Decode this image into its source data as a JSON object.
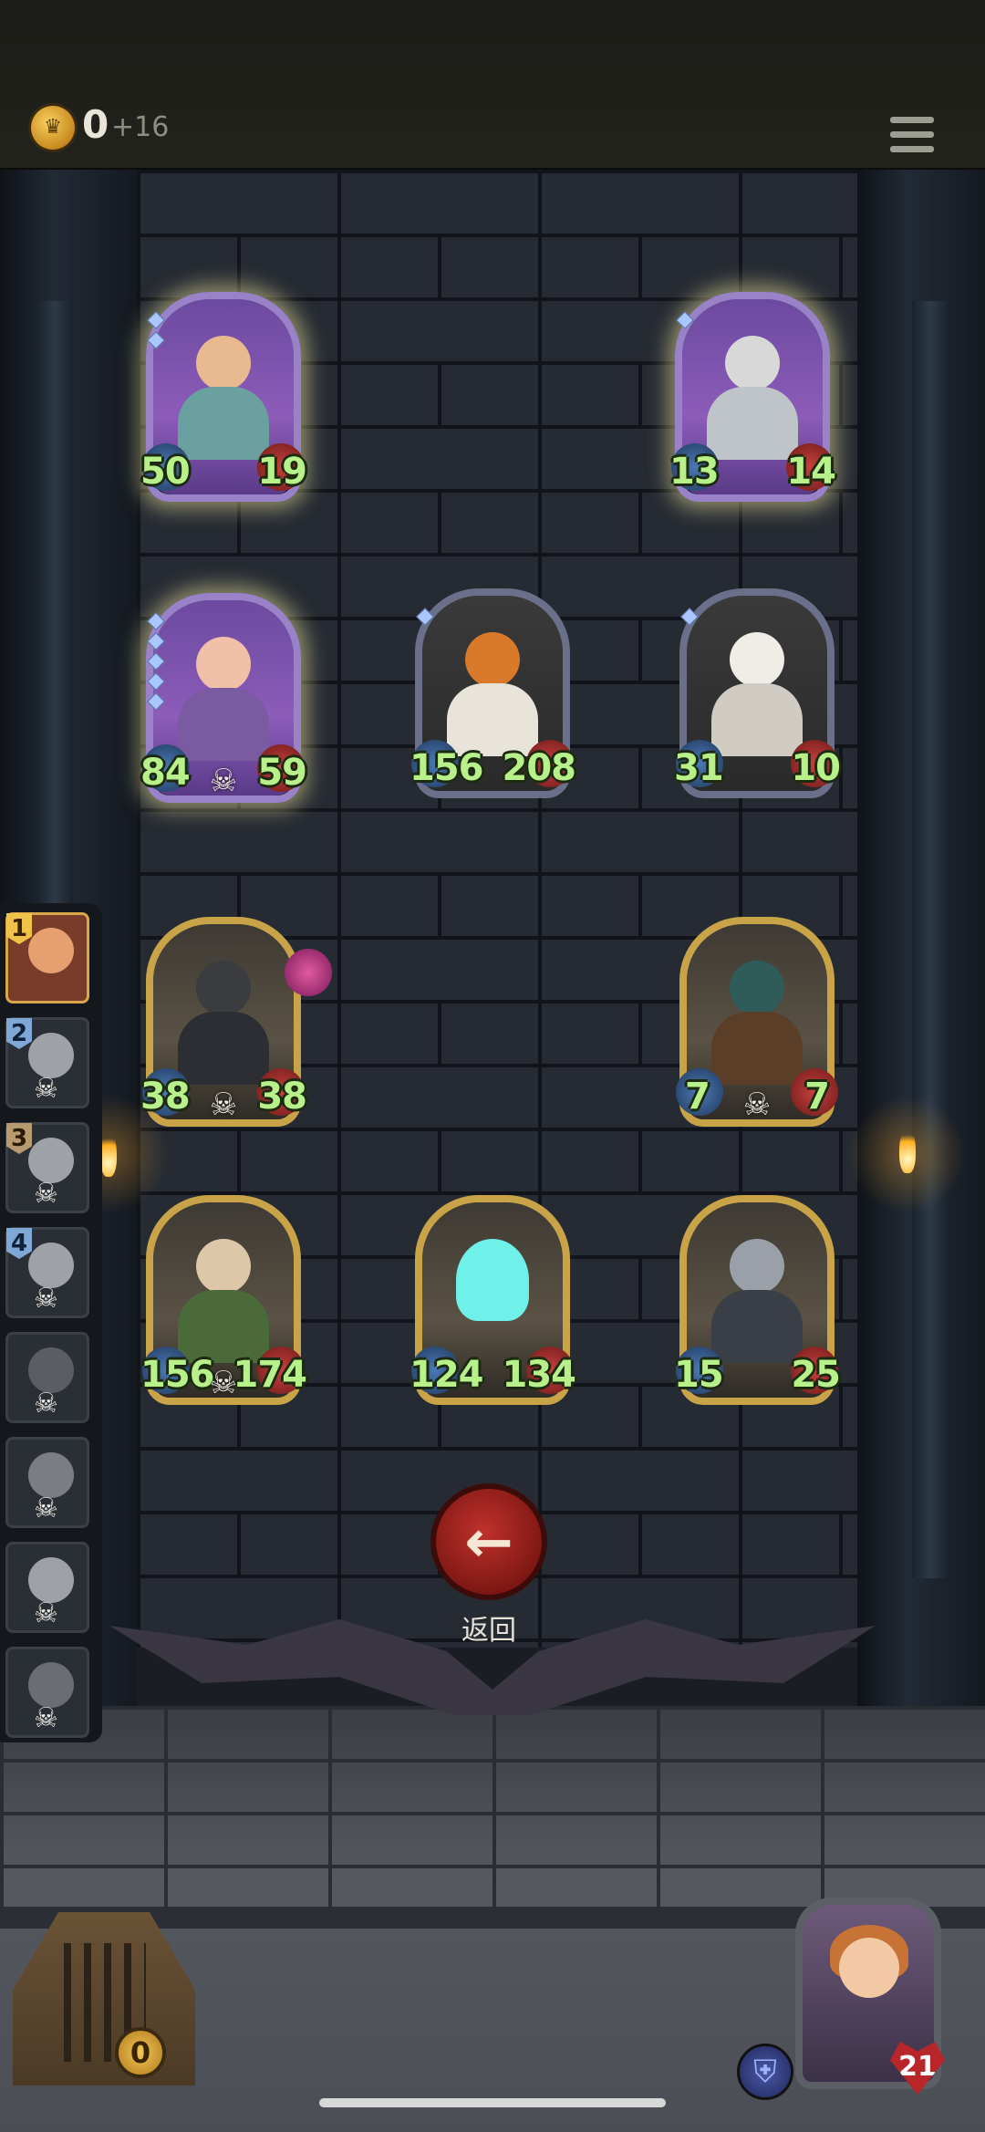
{
  "header": {
    "coins": "0",
    "coin_gain": "+16"
  },
  "cards": [
    {
      "atk": "50",
      "hp": "19"
    },
    {
      "atk": "13",
      "hp": "14"
    },
    {
      "atk": "84",
      "hp": "59"
    },
    {
      "atk": "156",
      "hp": "208"
    },
    {
      "atk": "31",
      "hp": "10"
    },
    {
      "atk": "38",
      "hp": "38"
    },
    {
      "atk": "7",
      "hp": "7"
    },
    {
      "atk": "156",
      "hp": "174"
    },
    {
      "atk": "124",
      "hp": "134"
    },
    {
      "atk": "15",
      "hp": "25"
    }
  ],
  "roster": [
    {
      "number": "1"
    },
    {
      "number": "2"
    },
    {
      "number": "3"
    },
    {
      "number": "4"
    }
  ],
  "back_button": {
    "label": "返回",
    "icon": "back-arrow-icon"
  },
  "bottom": {
    "cage_count": "0",
    "hero_hp": "21"
  },
  "icons": {
    "skull": "skull-icon",
    "shield": "shield-icon",
    "menu": "menu-icon",
    "coin": "crown-coin-icon"
  },
  "colors": {
    "stat_green": "#b8f08a",
    "back_red": "#c0312b",
    "frame_gold": "#c9a347",
    "frame_purple": "#9a82c8"
  }
}
